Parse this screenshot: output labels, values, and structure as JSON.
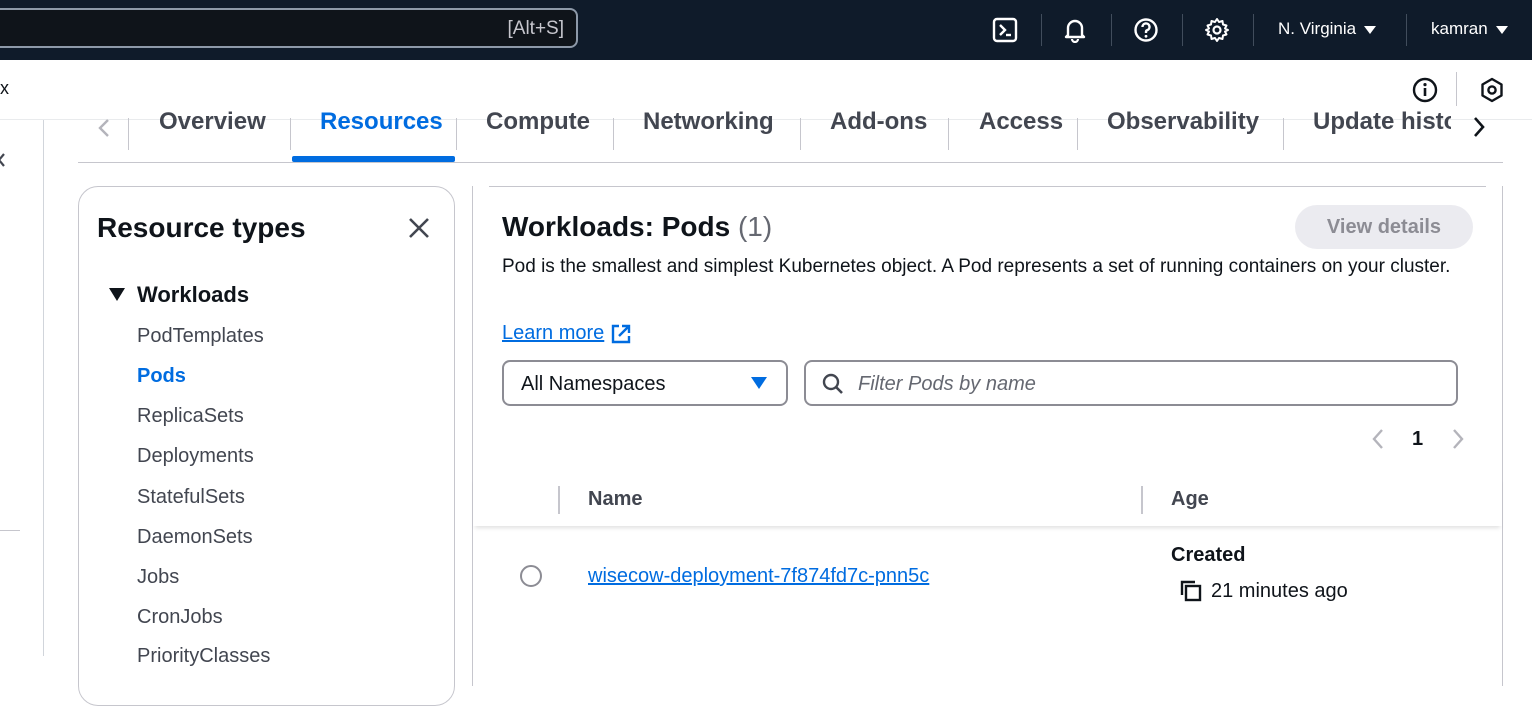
{
  "topnav": {
    "search_shortcut": "[Alt+S]",
    "region": "N. Virginia",
    "user": "kamran"
  },
  "subheader": {
    "close_fragment": "x"
  },
  "tabs": [
    {
      "label": "Overview"
    },
    {
      "label": "Resources",
      "active": true
    },
    {
      "label": "Compute"
    },
    {
      "label": "Networking"
    },
    {
      "label": "Add-ons"
    },
    {
      "label": "Access"
    },
    {
      "label": "Observability"
    },
    {
      "label": "Update histo"
    }
  ],
  "resource_types": {
    "title": "Resource types",
    "group": "Workloads",
    "items": [
      {
        "label": "PodTemplates"
      },
      {
        "label": "Pods",
        "active": true
      },
      {
        "label": "ReplicaSets"
      },
      {
        "label": "Deployments"
      },
      {
        "label": "StatefulSets"
      },
      {
        "label": "DaemonSets"
      },
      {
        "label": "Jobs"
      },
      {
        "label": "CronJobs"
      },
      {
        "label": "PriorityClasses"
      }
    ]
  },
  "pods": {
    "title": "Workloads: Pods",
    "count": "(1)",
    "view_details": "View details",
    "description": "Pod is the smallest and simplest Kubernetes object. A Pod represents a set of running containers on your cluster.",
    "learn_more": "Learn more",
    "namespace_select": "All Namespaces",
    "filter_placeholder": "Filter Pods by name",
    "page": "1",
    "columns": {
      "name": "Name",
      "age": "Age"
    },
    "rows": [
      {
        "name": "wisecow-deployment-7f874fd7c-pnn5c",
        "age_label": "Created",
        "age_value": "21 minutes ago"
      }
    ]
  },
  "colors": {
    "accent": "#006ce0",
    "nav_bg": "#0f1b2a"
  }
}
